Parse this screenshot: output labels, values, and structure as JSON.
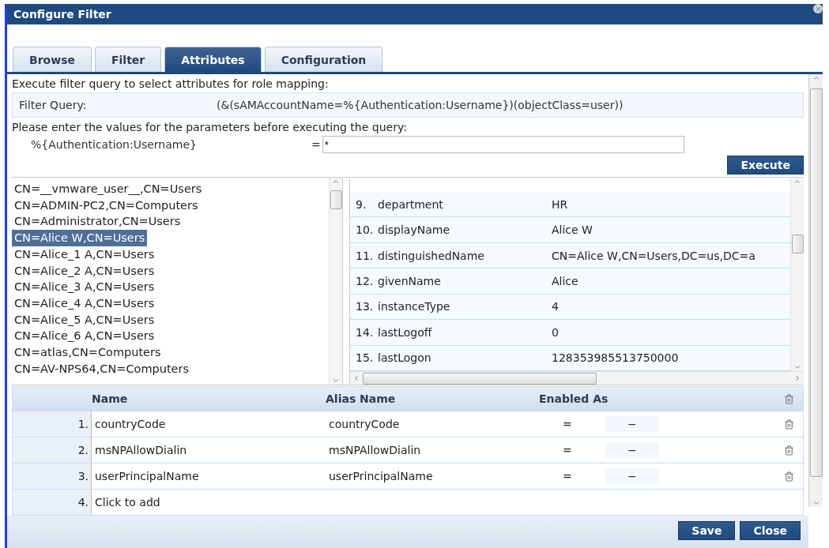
{
  "window": {
    "title": "Configure Filter"
  },
  "tabs": [
    {
      "label": "Browse",
      "selected": false
    },
    {
      "label": "Filter",
      "selected": false
    },
    {
      "label": "Attributes",
      "selected": true
    },
    {
      "label": "Configuration",
      "selected": false
    }
  ],
  "intro": "Execute filter query to select attributes for role mapping:",
  "filter_query": {
    "label": "Filter Query:",
    "value": "(&(sAMAccountName=%{Authentication:Username})(objectClass=user))"
  },
  "prompt": "Please enter the values for the parameters before executing the query:",
  "parameter": {
    "name": "%{Authentication:Username}",
    "equals": "=",
    "value": "*"
  },
  "execute_button": "Execute",
  "entries": [
    {
      "label": "CN=__vmware_user__,CN=Users",
      "selected": false
    },
    {
      "label": "CN=ADMIN-PC2,CN=Computers",
      "selected": false
    },
    {
      "label": "CN=Administrator,CN=Users",
      "selected": false
    },
    {
      "label": "CN=Alice W,CN=Users",
      "selected": true
    },
    {
      "label": "CN=Alice_1 A,CN=Users",
      "selected": false
    },
    {
      "label": "CN=Alice_2 A,CN=Users",
      "selected": false
    },
    {
      "label": "CN=Alice_3 A,CN=Users",
      "selected": false
    },
    {
      "label": "CN=Alice_4 A,CN=Users",
      "selected": false
    },
    {
      "label": "CN=Alice_5 A,CN=Users",
      "selected": false
    },
    {
      "label": "CN=Alice_6 A,CN=Users",
      "selected": false
    },
    {
      "label": "CN=atlas,CN=Computers",
      "selected": false
    },
    {
      "label": "CN=AV-NPS64,CN=Computers",
      "selected": false
    }
  ],
  "attributes": [
    {
      "index": "9.",
      "name": "department",
      "value": "HR"
    },
    {
      "index": "10.",
      "name": "displayName",
      "value": "Alice W"
    },
    {
      "index": "11.",
      "name": "distinguishedName",
      "value": "CN=Alice W,CN=Users,DC=us,DC=a"
    },
    {
      "index": "12.",
      "name": "givenName",
      "value": "Alice"
    },
    {
      "index": "13.",
      "name": "instanceType",
      "value": "4"
    },
    {
      "index": "14.",
      "name": "lastLogoff",
      "value": "0"
    },
    {
      "index": "15.",
      "name": "lastLogon",
      "value": "128353985513750000"
    }
  ],
  "table": {
    "columns": [
      "Name",
      "Alias Name",
      "Enabled As"
    ],
    "rows": [
      {
        "index": "1.",
        "name": "countryCode",
        "alias": "countryCode",
        "equals": "=",
        "enabled_as": "−"
      },
      {
        "index": "2.",
        "name": "msNPAllowDialin",
        "alias": "msNPAllowDialin",
        "equals": "=",
        "enabled_as": "−"
      },
      {
        "index": "3.",
        "name": "userPrincipalName",
        "alias": "userPrincipalName",
        "equals": "=",
        "enabled_as": "−"
      }
    ],
    "add_row": {
      "index": "4.",
      "label": "Click to add"
    }
  },
  "buttons": [
    "Save",
    "Close"
  ]
}
